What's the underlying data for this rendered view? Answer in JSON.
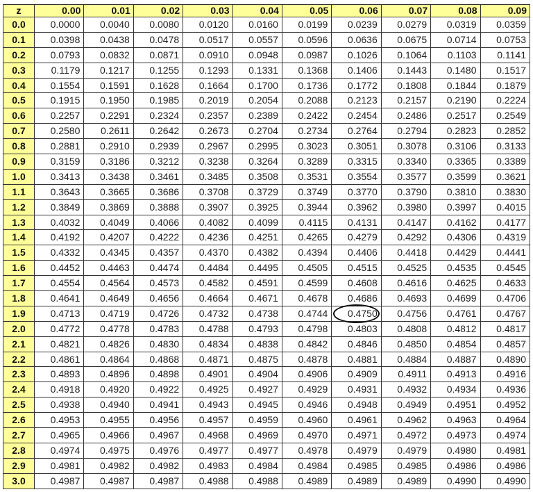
{
  "header": {
    "corner": "z",
    "columns": [
      "0.00",
      "0.01",
      "0.02",
      "0.03",
      "0.04",
      "0.05",
      "0.06",
      "0.07",
      "0.08",
      "0.09"
    ]
  },
  "highlight": {
    "row": 19,
    "col": 6,
    "value": "0.4750"
  },
  "rows": [
    {
      "z": "0.0",
      "v": [
        "0.0000",
        "0.0040",
        "0.0080",
        "0.0120",
        "0.0160",
        "0.0199",
        "0.0239",
        "0.0279",
        "0.0319",
        "0.0359"
      ]
    },
    {
      "z": "0.1",
      "v": [
        "0.0398",
        "0.0438",
        "0.0478",
        "0.0517",
        "0.0557",
        "0.0596",
        "0.0636",
        "0.0675",
        "0.0714",
        "0.0753"
      ]
    },
    {
      "z": "0.2",
      "v": [
        "0.0793",
        "0.0832",
        "0.0871",
        "0.0910",
        "0.0948",
        "0.0987",
        "0.1026",
        "0.1064",
        "0.1103",
        "0.1141"
      ]
    },
    {
      "z": "0.3",
      "v": [
        "0.1179",
        "0.1217",
        "0.1255",
        "0.1293",
        "0.1331",
        "0.1368",
        "0.1406",
        "0.1443",
        "0.1480",
        "0.1517"
      ]
    },
    {
      "z": "0.4",
      "v": [
        "0.1554",
        "0.1591",
        "0.1628",
        "0.1664",
        "0.1700",
        "0.1736",
        "0.1772",
        "0.1808",
        "0.1844",
        "0.1879"
      ]
    },
    {
      "z": "0.5",
      "v": [
        "0.1915",
        "0.1950",
        "0.1985",
        "0.2019",
        "0.2054",
        "0.2088",
        "0.2123",
        "0.2157",
        "0.2190",
        "0.2224"
      ]
    },
    {
      "z": "0.6",
      "v": [
        "0.2257",
        "0.2291",
        "0.2324",
        "0.2357",
        "0.2389",
        "0.2422",
        "0.2454",
        "0.2486",
        "0.2517",
        "0.2549"
      ]
    },
    {
      "z": "0.7",
      "v": [
        "0.2580",
        "0.2611",
        "0.2642",
        "0.2673",
        "0.2704",
        "0.2734",
        "0.2764",
        "0.2794",
        "0.2823",
        "0.2852"
      ]
    },
    {
      "z": "0.8",
      "v": [
        "0.2881",
        "0.2910",
        "0.2939",
        "0.2967",
        "0.2995",
        "0.3023",
        "0.3051",
        "0.3078",
        "0.3106",
        "0.3133"
      ]
    },
    {
      "z": "0.9",
      "v": [
        "0.3159",
        "0.3186",
        "0.3212",
        "0.3238",
        "0.3264",
        "0.3289",
        "0.3315",
        "0.3340",
        "0.3365",
        "0.3389"
      ]
    },
    {
      "z": "1.0",
      "v": [
        "0.3413",
        "0.3438",
        "0.3461",
        "0.3485",
        "0.3508",
        "0.3531",
        "0.3554",
        "0.3577",
        "0.3599",
        "0.3621"
      ]
    },
    {
      "z": "1.1",
      "v": [
        "0.3643",
        "0.3665",
        "0.3686",
        "0.3708",
        "0.3729",
        "0.3749",
        "0.3770",
        "0.3790",
        "0.3810",
        "0.3830"
      ]
    },
    {
      "z": "1.2",
      "v": [
        "0.3849",
        "0.3869",
        "0.3888",
        "0.3907",
        "0.3925",
        "0.3944",
        "0.3962",
        "0.3980",
        "0.3997",
        "0.4015"
      ]
    },
    {
      "z": "1.3",
      "v": [
        "0.4032",
        "0.4049",
        "0.4066",
        "0.4082",
        "0.4099",
        "0.4115",
        "0.4131",
        "0.4147",
        "0.4162",
        "0.4177"
      ]
    },
    {
      "z": "1.4",
      "v": [
        "0.4192",
        "0.4207",
        "0.4222",
        "0.4236",
        "0.4251",
        "0.4265",
        "0.4279",
        "0.4292",
        "0.4306",
        "0.4319"
      ]
    },
    {
      "z": "1.5",
      "v": [
        "0.4332",
        "0.4345",
        "0.4357",
        "0.4370",
        "0.4382",
        "0.4394",
        "0.4406",
        "0.4418",
        "0.4429",
        "0.4441"
      ]
    },
    {
      "z": "1.6",
      "v": [
        "0.4452",
        "0.4463",
        "0.4474",
        "0.4484",
        "0.4495",
        "0.4505",
        "0.4515",
        "0.4525",
        "0.4535",
        "0.4545"
      ]
    },
    {
      "z": "1.7",
      "v": [
        "0.4554",
        "0.4564",
        "0.4573",
        "0.4582",
        "0.4591",
        "0.4599",
        "0.4608",
        "0.4616",
        "0.4625",
        "0.4633"
      ]
    },
    {
      "z": "1.8",
      "v": [
        "0.4641",
        "0.4649",
        "0.4656",
        "0.4664",
        "0.4671",
        "0.4678",
        "0.4686",
        "0.4693",
        "0.4699",
        "0.4706"
      ]
    },
    {
      "z": "1.9",
      "v": [
        "0.4713",
        "0.4719",
        "0.4726",
        "0.4732",
        "0.4738",
        "0.4744",
        "0.4750",
        "0.4756",
        "0.4761",
        "0.4767"
      ]
    },
    {
      "z": "2.0",
      "v": [
        "0.4772",
        "0.4778",
        "0.4783",
        "0.4788",
        "0.4793",
        "0.4798",
        "0.4803",
        "0.4808",
        "0.4812",
        "0.4817"
      ]
    },
    {
      "z": "2.1",
      "v": [
        "0.4821",
        "0.4826",
        "0.4830",
        "0.4834",
        "0.4838",
        "0.4842",
        "0.4846",
        "0.4850",
        "0.4854",
        "0.4857"
      ]
    },
    {
      "z": "2.2",
      "v": [
        "0.4861",
        "0.4864",
        "0.4868",
        "0.4871",
        "0.4875",
        "0.4878",
        "0.4881",
        "0.4884",
        "0.4887",
        "0.4890"
      ]
    },
    {
      "z": "2.3",
      "v": [
        "0.4893",
        "0.4896",
        "0.4898",
        "0.4901",
        "0.4904",
        "0.4906",
        "0.4909",
        "0.4911",
        "0.4913",
        "0.4916"
      ]
    },
    {
      "z": "2.4",
      "v": [
        "0.4918",
        "0.4920",
        "0.4922",
        "0.4925",
        "0.4927",
        "0.4929",
        "0.4931",
        "0.4932",
        "0.4934",
        "0.4936"
      ]
    },
    {
      "z": "2.5",
      "v": [
        "0.4938",
        "0.4940",
        "0.4941",
        "0.4943",
        "0.4945",
        "0.4946",
        "0.4948",
        "0.4949",
        "0.4951",
        "0.4952"
      ]
    },
    {
      "z": "2.6",
      "v": [
        "0.4953",
        "0.4955",
        "0.4956",
        "0.4957",
        "0.4959",
        "0.4960",
        "0.4961",
        "0.4962",
        "0.4963",
        "0.4964"
      ]
    },
    {
      "z": "2.7",
      "v": [
        "0.4965",
        "0.4966",
        "0.4967",
        "0.4968",
        "0.4969",
        "0.4970",
        "0.4971",
        "0.4972",
        "0.4973",
        "0.4974"
      ]
    },
    {
      "z": "2.8",
      "v": [
        "0.4974",
        "0.4975",
        "0.4976",
        "0.4977",
        "0.4977",
        "0.4978",
        "0.4979",
        "0.4979",
        "0.4980",
        "0.4981"
      ]
    },
    {
      "z": "2.9",
      "v": [
        "0.4981",
        "0.4982",
        "0.4982",
        "0.4983",
        "0.4984",
        "0.4984",
        "0.4985",
        "0.4985",
        "0.4986",
        "0.4986"
      ]
    },
    {
      "z": "3.0",
      "v": [
        "0.4987",
        "0.4987",
        "0.4987",
        "0.4988",
        "0.4988",
        "0.4989",
        "0.4989",
        "0.4989",
        "0.4990",
        "0.4990"
      ]
    }
  ]
}
